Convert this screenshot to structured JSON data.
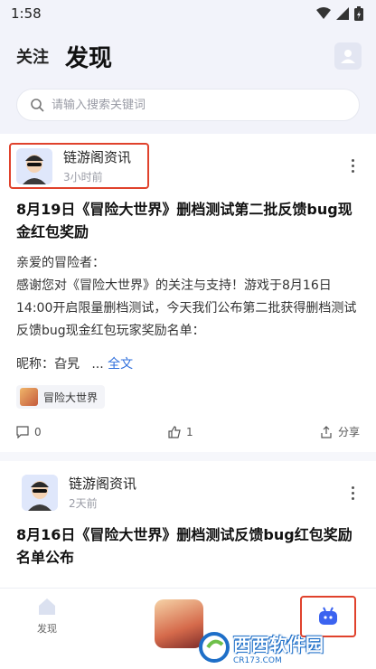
{
  "status": {
    "time": "1:58"
  },
  "header": {
    "tab_follow": "关注",
    "tab_discover": "发现"
  },
  "search": {
    "placeholder": "请输入搜索关键词"
  },
  "posts": [
    {
      "author": "链游阁资讯",
      "time": "3小时前",
      "title": "8月19日《冒险大世界》删档测试第二批反馈bug现金红包奖励",
      "body_lines": [
        "亲爱的冒险者：",
        "感谢您对《冒险大世界》的关注与支持！游戏于8月16日14:00开启限量删档测试，今天我们公布第二批获得删档测试反馈bug现金红包玩家奖励名单："
      ],
      "nick_label": "昵称：",
      "nick_value": "旮旯",
      "ellipsis": "...",
      "fulltext": "全文",
      "tag": "冒险大世界",
      "comments": "0",
      "likes": "1",
      "share": "分享"
    },
    {
      "author": "链游阁资讯",
      "time": "2天前",
      "title": "8月16日《冒险大世界》删档测试反馈bug红包奖励名单公布"
    }
  ],
  "bottom_nav": {
    "discover_label": "发现"
  },
  "watermark": {
    "text": "西西软件园",
    "sub": "CR173.COM"
  },
  "colors": {
    "accent": "#2f6fdc",
    "highlight": "#e0422c",
    "page_bg": "#f2f3fa"
  }
}
